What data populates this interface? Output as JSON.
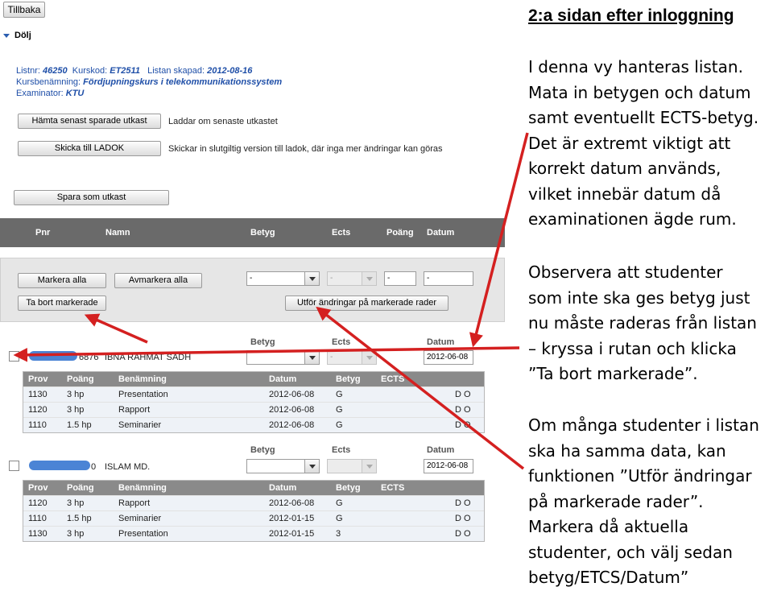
{
  "nav": {
    "back_label": "Tillbaka",
    "hide_label": "Dölj"
  },
  "info": {
    "listnr_label": "Listnr:",
    "listnr": "46250",
    "kurskod_label": "Kurskod:",
    "kurskod": "ET2511",
    "skapad_label": "Listan skapad:",
    "skapad": "2012-08-16",
    "kursbenamning_label": "Kursbenämning:",
    "kursbenamning": "Fördjupningskurs i telekommunikationssystem",
    "examinator_label": "Examinator:",
    "examinator": "KTU"
  },
  "actions": {
    "fetch_label": "Hämta senast sparade utkast",
    "fetch_note": "Laddar om senaste utkastet",
    "send_label": "Skicka till LADOK",
    "send_note": "Skickar in slutgiltig version till ladok, där inga mer ändringar kan göras",
    "save_label": "Spara som utkast"
  },
  "columns": [
    "Pnr",
    "Namn",
    "Betyg",
    "Ects",
    "Poäng",
    "Datum"
  ],
  "bulk": {
    "mark_all": "Markera alla",
    "unmark_all": "Avmarkera alla",
    "remove_marked": "Ta bort markerade",
    "apply_marked": "Utför ändringar på markerade rader",
    "betyg_value": "-",
    "ects_value": "-",
    "poang_value": "-",
    "datum_value": "-"
  },
  "labels": {
    "betyg": "Betyg",
    "ects": "Ects",
    "datum": "Datum"
  },
  "subheaders": [
    "Prov",
    "Poäng",
    "Benämning",
    "Datum",
    "Betyg",
    "ECTS"
  ],
  "students": [
    {
      "pnr_suffix": "6876",
      "name": "IBNA RAHMAT SADH",
      "datum": "2012-06-08",
      "rows": [
        {
          "prov": "1130",
          "poang": "3 hp",
          "ben": "Presentation",
          "datum": "2012-06-08",
          "betyg": "G",
          "flags": "D O"
        },
        {
          "prov": "1120",
          "poang": "3 hp",
          "ben": "Rapport",
          "datum": "2012-06-08",
          "betyg": "G",
          "flags": "D O"
        },
        {
          "prov": "1110",
          "poang": "1.5 hp",
          "ben": "Seminarier",
          "datum": "2012-06-08",
          "betyg": "G",
          "flags": "D O"
        }
      ]
    },
    {
      "pnr_suffix": "0",
      "name": "ISLAM MD.",
      "datum": "2012-06-08",
      "rows": [
        {
          "prov": "1120",
          "poang": "3 hp",
          "ben": "Rapport",
          "datum": "2012-06-08",
          "betyg": "G",
          "flags": "D O"
        },
        {
          "prov": "1110",
          "poang": "1.5 hp",
          "ben": "Seminarier",
          "datum": "2012-01-15",
          "betyg": "G",
          "flags": "D O"
        },
        {
          "prov": "1130",
          "poang": "3 hp",
          "ben": "Presentation",
          "datum": "2012-01-15",
          "betyg": "3",
          "flags": "D O"
        }
      ]
    }
  ],
  "explanation": {
    "title": "2:a sidan efter inloggning",
    "p1": [
      "I denna vy hanteras listan.",
      "Mata in betygen och datum",
      "samt eventuellt ECTS-betyg.",
      "Det är extremt viktigt att",
      "korrekt datum används,",
      "vilket innebär datum då",
      "examinationen ägde rum."
    ],
    "p2": [
      "Observera att studenter",
      "som inte ska ges betyg just",
      "nu måste raderas från listan",
      "– kryssa i rutan och klicka",
      "”Ta bort markerade”."
    ],
    "p3": [
      "Om många studenter i listan",
      "ska ha samma data, kan",
      "funktionen ”Utför ändringar",
      "på markerade rader”.",
      "Markera då aktuella",
      "studenter, och välj sedan",
      "betyg/ETCS/Datum”"
    ]
  },
  "colors": {
    "header_bg": "#6a6a6a",
    "arrow": "#d42020",
    "info_text": "#1f4fa8"
  }
}
